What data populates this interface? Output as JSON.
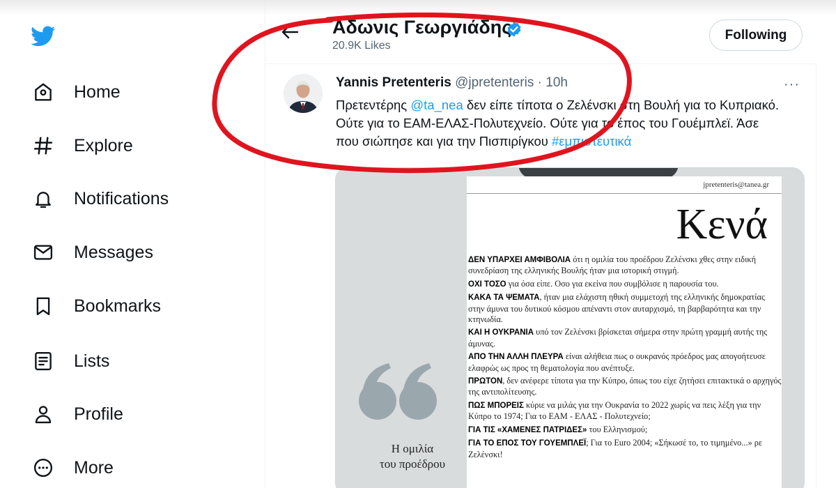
{
  "sidebar": {
    "logo": "twitter-bird-icon",
    "items": [
      {
        "label": "Home",
        "icon": "home-icon"
      },
      {
        "label": "Explore",
        "icon": "hashtag-icon"
      },
      {
        "label": "Notifications",
        "icon": "bell-icon"
      },
      {
        "label": "Messages",
        "icon": "envelope-icon"
      },
      {
        "label": "Bookmarks",
        "icon": "bookmark-icon"
      },
      {
        "label": "Lists",
        "icon": "list-icon"
      },
      {
        "label": "Profile",
        "icon": "person-icon"
      },
      {
        "label": "More",
        "icon": "more-circle-icon"
      }
    ]
  },
  "header": {
    "name": "Αδωνις Γεωργιάδης",
    "likes": "20.9K Likes",
    "follow_label": "Following"
  },
  "tweet": {
    "author": "Yannis Pretenteris",
    "handle": "@jpretenteris",
    "separator": "·",
    "time": "10h",
    "more": "···",
    "text_1": "Πρετεντέρης ",
    "mention": "@ta_nea",
    "text_2": " δεν είπε τίποτα ο Ζελένσκι στη Βουλή για το Κυπριακό. Ούτε για το ΕΑΜ-ΕΛΑΣ-Πολυτεχνείο. Ούτε για το έπος του Γουέμπλεϊ. Άσε που σιώπησε και για την Πισπιρίγκου ",
    "hashtag": "#εμπιστευτικά"
  },
  "article": {
    "email": "jpretenteris@tanea.gr",
    "title": "Κενά",
    "paragraphs": [
      {
        "lead": "ΔΕΝ ΥΠΑΡΧΕΙ ΑΜΦΙΒΟΛΙΑ",
        "body": " ότι η ομιλία του προέδρου Ζελένσκι χθες στην ειδική συνεδρίαση της ελληνικής Βουλής ήταν μια ιστορική στιγμή."
      },
      {
        "lead": "ΟΧΙ ΤΟΣΟ",
        "body": " για όσα είπε. Οσο για εκείνα που συμβόλισε η παρουσία του."
      },
      {
        "lead": "ΚΑΚΑ ΤΑ ΨΕΜΑΤΑ",
        "body": ", ήταν μια ελάχιστη ηθική συμμετοχή της ελληνικής δημοκρατίας στην άμυνα του δυτικού κόσμου απέναντι στον αυταρχισμό, τη βαρβαρότητα και την κτηνωδία."
      },
      {
        "lead": "ΚΑΙ Η ΟΥΚΡΑΝΙΑ",
        "body": " υπό τον Ζελένσκι βρίσκεται σήμερα στην πρώτη γραμμή αυτής της άμυνας."
      },
      {
        "lead": "ΑΠΟ ΤΗΝ ΑΛΛΗ ΠΛΕΥΡΑ",
        "body": " είναι αλήθεια πως ο ουκρανός πρόεδρος μας απογοήτευσε ελαφρώς ως προς τη θεματολογία που ανέπτυξε."
      },
      {
        "lead": "ΠΡΩΤΟΝ",
        "body": ", δεν ανέφερε τίποτα για την Κύπρο, όπως του είχε ζητήσει επιτακτικά ο αρχηγός της αντιπολίτευσης."
      },
      {
        "lead": "ΠΩΣ ΜΠΟΡΕΙΣ",
        "body": " κύριε να μιλάς για την Ουκρανία το 2022 χωρίς να πεις λέξη για την Κύπρο το 1974; Για το ΕΑΜ - ΕΛΑΣ - Πολυτεχνείο;"
      },
      {
        "lead": "ΓΙΑ ΤΙΣ «ΧΑΜΕΝΕΣ ΠΑΤΡΙΔΕΣ»",
        "body": " του Ελληνισμού;"
      },
      {
        "lead": "ΓΙΑ ΤΟ ΕΠΟΣ ΤΟΥ ΓΟΥΕΜΠΛΕΪ",
        "body": "; Για το Euro 2004; «Σήκωσέ το, το τιμημένο...» ρε Ζελένσκι!"
      }
    ],
    "pull_quote_line1": "Η ομιλία",
    "pull_quote_line2": "του προέδρου"
  },
  "colors": {
    "brand": "#1d9bf0",
    "text": "#0f1419",
    "muted": "#536471",
    "annotation": "#e0141e"
  }
}
